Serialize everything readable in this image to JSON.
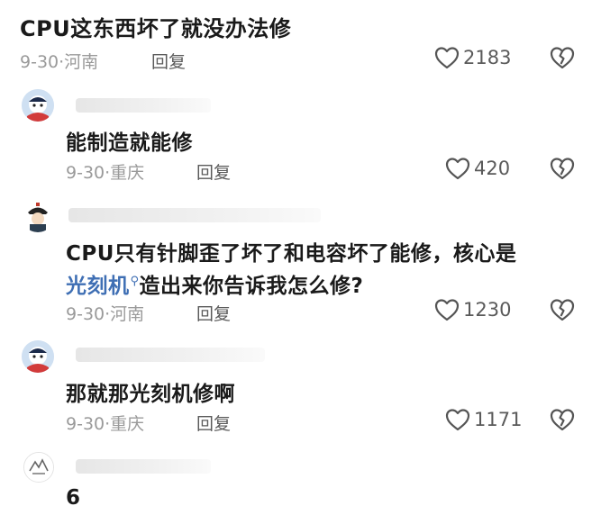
{
  "comments": [
    {
      "text": "CPU这东西坏了就没办法修",
      "date": "9-30",
      "location": "河南",
      "reply_label": "回复",
      "likes": "2183"
    },
    {
      "text": "能制造就能修",
      "date": "9-30",
      "location": "重庆",
      "reply_label": "回复",
      "likes": "420"
    },
    {
      "text_line1": "CPU只有针脚歪了坏了和电容坏了能修，核心是",
      "text_link": "光刻机",
      "text_line2_rest": "造出来你告诉我怎么修?",
      "date": "9-30",
      "location": "河南",
      "reply_label": "回复",
      "likes": "1230"
    },
    {
      "text": "那就那光刻机修啊",
      "date": "9-30",
      "location": "重庆",
      "reply_label": "回复",
      "likes": "1171"
    },
    {
      "text": "6"
    }
  ],
  "separator": "·",
  "icons": {
    "like": "heart-outline-icon",
    "dislike": "broken-heart-icon",
    "search": "search-icon"
  },
  "colors": {
    "link": "#3f6fb4",
    "meta": "#9a9a9a"
  }
}
